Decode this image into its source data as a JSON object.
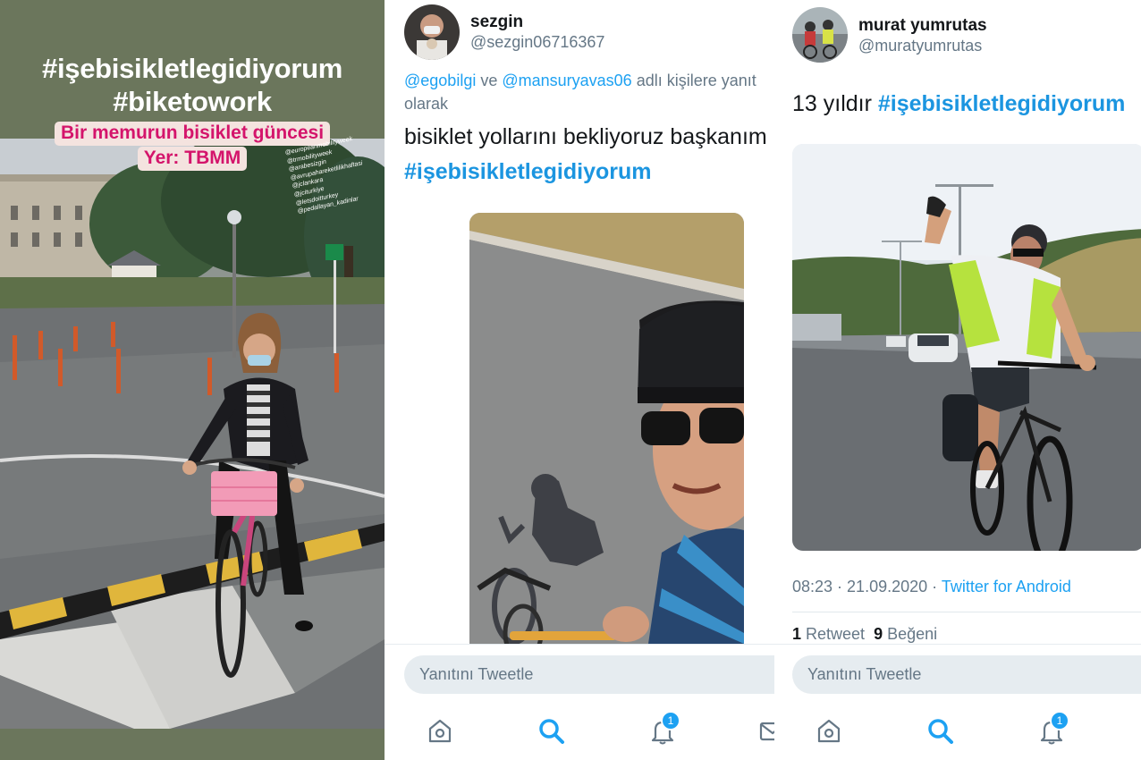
{
  "story": {
    "hashtag_line1": "#işebisikletlegidiyorum",
    "hashtag_line2": "#biketowork",
    "sticker_line1": "Bir memurun bisiklet güncesi",
    "sticker_line2": "Yer: TBMM",
    "mentions": [
      "@europeanmobilityweek",
      "@trmobilityweek",
      "@arabesizgin",
      "@avrupahareketlilikhaftasi",
      "@jclankara",
      "@jciturkiye",
      "@letsdoitturkey",
      "@pedallayan_kadinlar"
    ]
  },
  "tweet1": {
    "display_name": "sezgin",
    "handle": "@sezgin06716367",
    "reply_mention1": "@egobilgi",
    "reply_joiner": " ve ",
    "reply_mention2": "@mansuryavas06",
    "reply_suffix": " adlı kişilere yanıt olarak",
    "text": "bisiklet yollarını bekliyoruz başkanım",
    "hashtag": "#işebisikletlegidiyorum",
    "reply_placeholder": "Yanıtını Tweetle",
    "notification_count": "1"
  },
  "tweet2": {
    "display_name": "murat yumrutas",
    "handle": "@muratyumrutas",
    "text": "13 yıldır ",
    "hashtag": "#işebisikletlegidiyorum",
    "time": "08:23",
    "date_separator": " · ",
    "date": "21.09.2020",
    "source_separator": " · ",
    "source": "Twitter for Android",
    "retweet_count": "1",
    "retweet_label": " Retweet",
    "like_count": "9",
    "like_label": " Beğeni",
    "reply_placeholder": "Yanıtını Tweetle",
    "notification_count": "1"
  },
  "colors": {
    "twitter_blue": "#1da1f2",
    "story_green": "#6b765c",
    "sticker_magenta": "#d4146b"
  },
  "icons": [
    "home-icon",
    "search-icon",
    "bell-icon",
    "mail-icon"
  ]
}
